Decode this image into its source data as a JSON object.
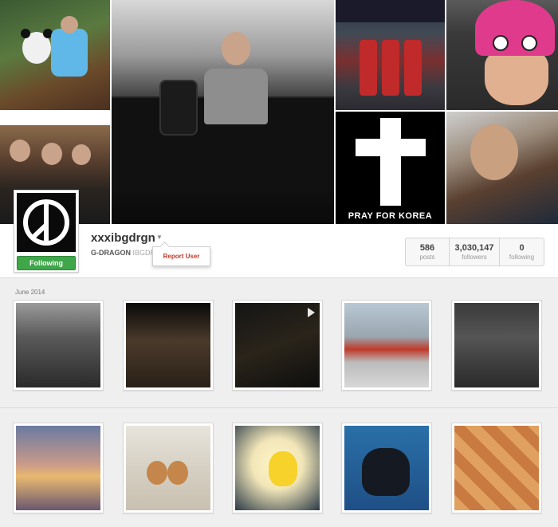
{
  "mosaic": {
    "cross_caption": "PRAY FOR KOREA"
  },
  "profile": {
    "username": "xxxibgdrgn",
    "display_name": "G-DRAGON",
    "handle_fragment": "IBGDR",
    "follow_state": "Following",
    "menu": {
      "report_label": "Report User"
    },
    "stats": [
      {
        "value": "586",
        "label": "posts"
      },
      {
        "value": "3,030,147",
        "label": "followers"
      },
      {
        "value": "0",
        "label": "following"
      }
    ]
  },
  "feed": {
    "month_label": "June 2014"
  },
  "colors": {
    "follow_green": "#3fa64a",
    "report_red": "#c0392b",
    "background": "#efefef"
  }
}
